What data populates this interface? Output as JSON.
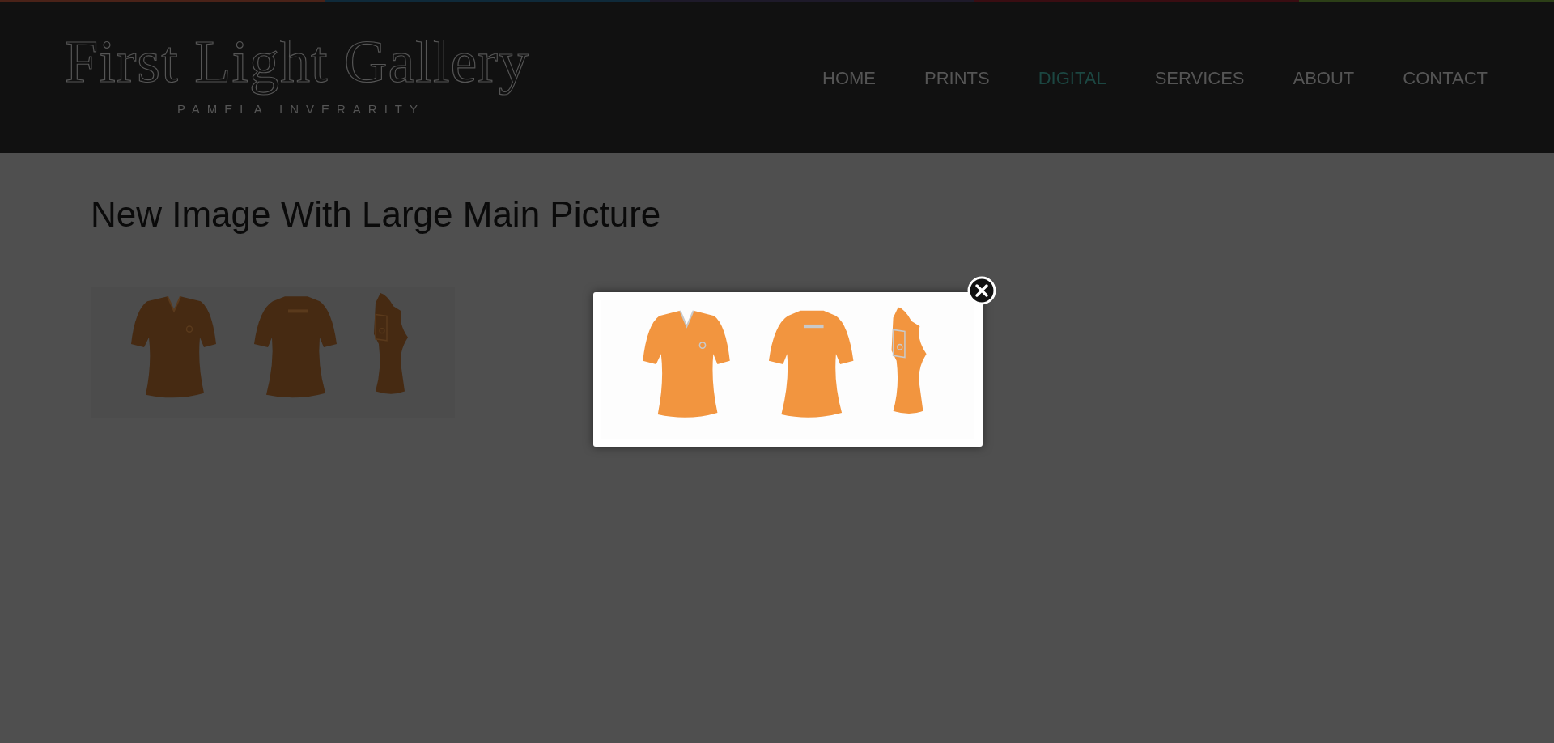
{
  "header": {
    "logo_title": "First Light Gallery",
    "logo_subtitle": "PAMELA INVERARITY"
  },
  "nav": [
    {
      "label": "HOME",
      "selected": false
    },
    {
      "label": "PRINTS",
      "selected": false
    },
    {
      "label": "DIGITAL",
      "selected": true
    },
    {
      "label": "SERVICES",
      "selected": false
    },
    {
      "label": "ABOUT",
      "selected": false
    },
    {
      "label": "CONTACT",
      "selected": false
    }
  ],
  "page_title": "New Image With Large Main Picture"
}
